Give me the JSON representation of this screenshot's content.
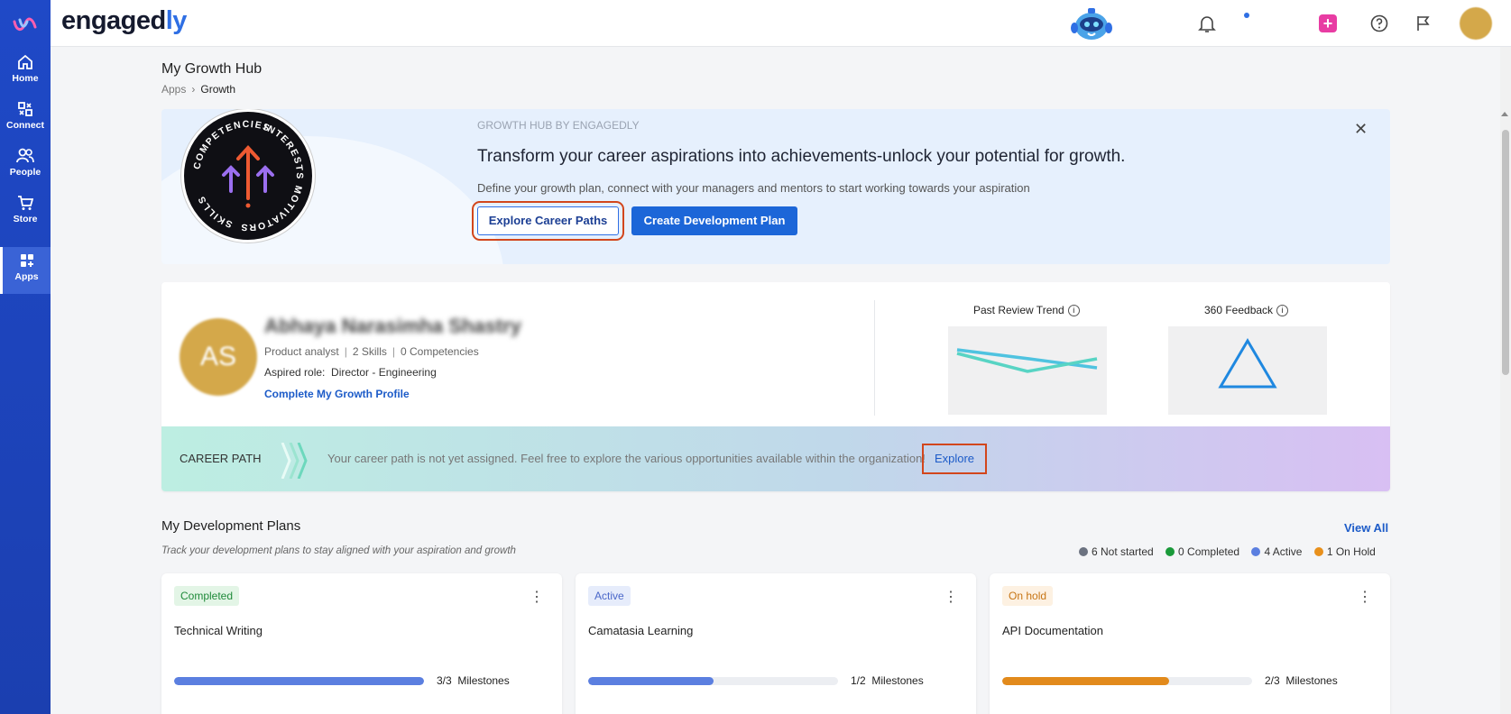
{
  "app": {
    "brand_main": "engaged",
    "brand_accent": "ly"
  },
  "sidebar": {
    "items": [
      {
        "label": "Home",
        "icon": "home-icon"
      },
      {
        "label": "Connect",
        "icon": "connect-icon"
      },
      {
        "label": "People",
        "icon": "people-icon"
      },
      {
        "label": "Store",
        "icon": "cart-icon"
      },
      {
        "label": "Apps",
        "icon": "apps-icon",
        "active": true
      }
    ]
  },
  "header": {
    "icons": [
      "mascot-icon",
      "bell-icon",
      "plus-icon",
      "help-icon",
      "flag-icon",
      "avatar"
    ]
  },
  "page": {
    "title": "My Growth Hub",
    "breadcrumb": [
      "Apps",
      "Growth"
    ]
  },
  "banner": {
    "eyebrow": "GROWTH HUB BY ENGAGEDLY",
    "title": "Transform your career aspirations into achievements-unlock your potential for growth.",
    "description": "Define your growth plan, connect with your managers and mentors to start working towards your aspiration",
    "primary_cta": "Create Development Plan",
    "secondary_cta": "Explore Career Paths",
    "badge_words": [
      "INTERESTS",
      "MOTIVATORS",
      "SKILLS",
      "COMPETENCIES"
    ]
  },
  "profile": {
    "initials": "AS",
    "name": "Abhaya Narasimha Shastry",
    "role": "Product analyst",
    "skills": "2 Skills",
    "competencies": "0 Competencies",
    "aspired_label": "Aspired role:",
    "aspired_role": "Director - Engineering",
    "profile_link": "Complete My Growth Profile",
    "past_review_label": "Past Review Trend",
    "feedback_label": "360 Feedback"
  },
  "career_path": {
    "label": "CAREER PATH",
    "message": "Your career path is not yet assigned. Feel free to explore the various opportunities available within the organization!",
    "explore": "Explore"
  },
  "dev_plans": {
    "title": "My Development Plans",
    "subtitle": "Track your development plans to stay aligned with your aspiration and growth",
    "view_all": "View All",
    "legend": [
      {
        "label": "6 Not started",
        "color": "#6b7280"
      },
      {
        "label": "0 Completed",
        "color": "#1a9a3a"
      },
      {
        "label": "4 Active",
        "color": "#5b7fe0"
      },
      {
        "label": "1 On Hold",
        "color": "#e8901c"
      }
    ],
    "cards": [
      {
        "status": "Completed",
        "name": "Technical Writing",
        "progress": 1.0,
        "milestones": "3/3",
        "milestones_label": "Milestones",
        "bar_color": "#5b7fe0",
        "badge_bg": "#e3f5e6",
        "badge_fg": "#1f8a3a"
      },
      {
        "status": "Active",
        "name": "Camatasia Learning",
        "progress": 0.5,
        "milestones": "1/2",
        "milestones_label": "Milestones",
        "bar_color": "#5b7fe0",
        "badge_bg": "#e6ecfb",
        "badge_fg": "#4a67c9"
      },
      {
        "status": "On hold",
        "name": "API Documentation",
        "progress": 0.667,
        "milestones": "2/3",
        "milestones_label": "Milestones",
        "bar_color": "#e28a1c",
        "badge_bg": "#fdf1e2",
        "badge_fg": "#c77514"
      }
    ]
  }
}
